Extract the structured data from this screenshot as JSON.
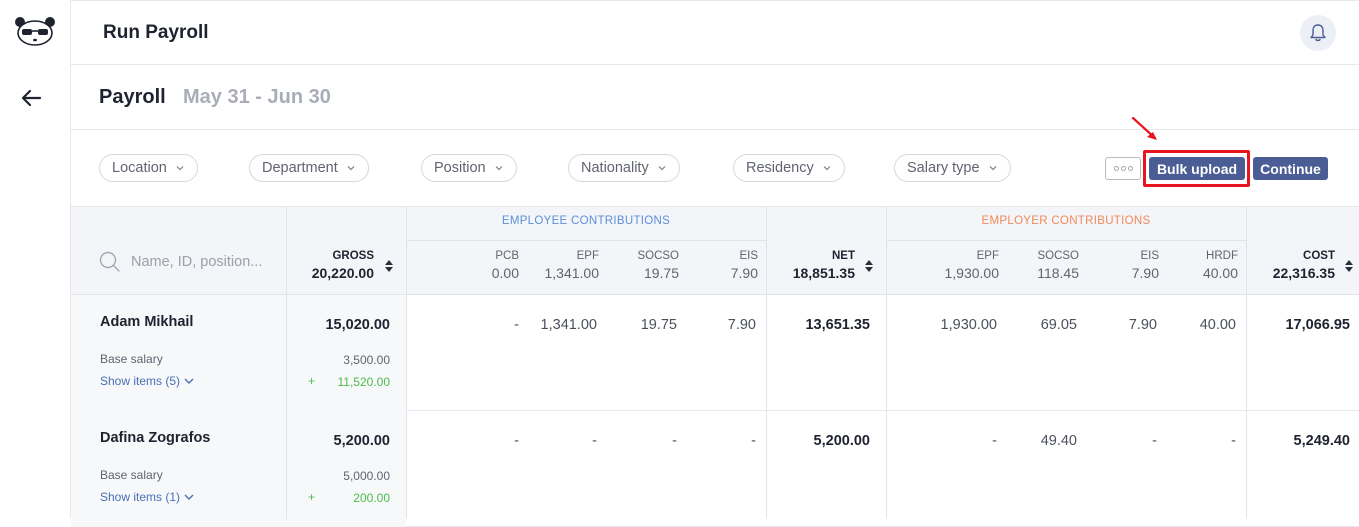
{
  "app": {
    "title": "Run Payroll"
  },
  "page": {
    "heading": "Payroll",
    "date_range": "May 31 - Jun 30"
  },
  "filters": [
    "Location",
    "Department",
    "Position",
    "Nationality",
    "Residency",
    "Salary type"
  ],
  "actions": {
    "bulk_upload": "Bulk upload",
    "continue": "Continue"
  },
  "search": {
    "placeholder": "Name, ID, position..."
  },
  "groups": {
    "employee": "EMPLOYEE CONTRIBUTIONS",
    "employer": "EMPLOYER CONTRIBUTIONS"
  },
  "columns": {
    "gross": {
      "label": "GROSS",
      "total": "20,220.00"
    },
    "pcb": {
      "label": "PCB",
      "total": "0.00"
    },
    "epf": {
      "label": "EPF",
      "total": "1,341.00"
    },
    "socso": {
      "label": "SOCSO",
      "total": "19.75"
    },
    "eis": {
      "label": "EIS",
      "total": "7.90"
    },
    "net": {
      "label": "NET",
      "total": "18,851.35"
    },
    "er_epf": {
      "label": "EPF",
      "total": "1,930.00"
    },
    "er_socso": {
      "label": "SOCSO",
      "total": "118.45"
    },
    "er_eis": {
      "label": "EIS",
      "total": "7.90"
    },
    "hrdf": {
      "label": "HRDF",
      "total": "40.00"
    },
    "cost": {
      "label": "COST",
      "total": "22,316.35"
    }
  },
  "rows": [
    {
      "name": "Adam Mikhail",
      "gross": "15,020.00",
      "base_label": "Base salary",
      "base_value": "3,500.00",
      "show_items": "Show items (5)",
      "plus": "+",
      "added": "11,520.00",
      "pcb": "-",
      "epf": "1,341.00",
      "socso": "19.75",
      "eis": "7.90",
      "net": "13,651.35",
      "er_epf": "1,930.00",
      "er_socso": "69.05",
      "er_eis": "7.90",
      "hrdf": "40.00",
      "cost": "17,066.95"
    },
    {
      "name": "Dafina Zografos",
      "gross": "5,200.00",
      "base_label": "Base salary",
      "base_value": "5,000.00",
      "show_items": "Show items (1)",
      "plus": "+",
      "added": "200.00",
      "pcb": "-",
      "epf": "-",
      "socso": "-",
      "eis": "-",
      "net": "5,200.00",
      "er_epf": "-",
      "er_socso": "49.40",
      "er_eis": "-",
      "hrdf": "-",
      "cost": "5,249.40"
    }
  ],
  "colors": {
    "primary_button": "#4a5d94",
    "employee_group": "#5b8fd9",
    "employer_group": "#f08a5a",
    "highlight": "#e8141e",
    "added_green": "#4cbb4c"
  },
  "icons": [
    "panda-logo-icon",
    "back-arrow-icon",
    "bell-icon",
    "chevron-down-icon",
    "more-dots-icon",
    "search-icon",
    "sort-icon"
  ]
}
